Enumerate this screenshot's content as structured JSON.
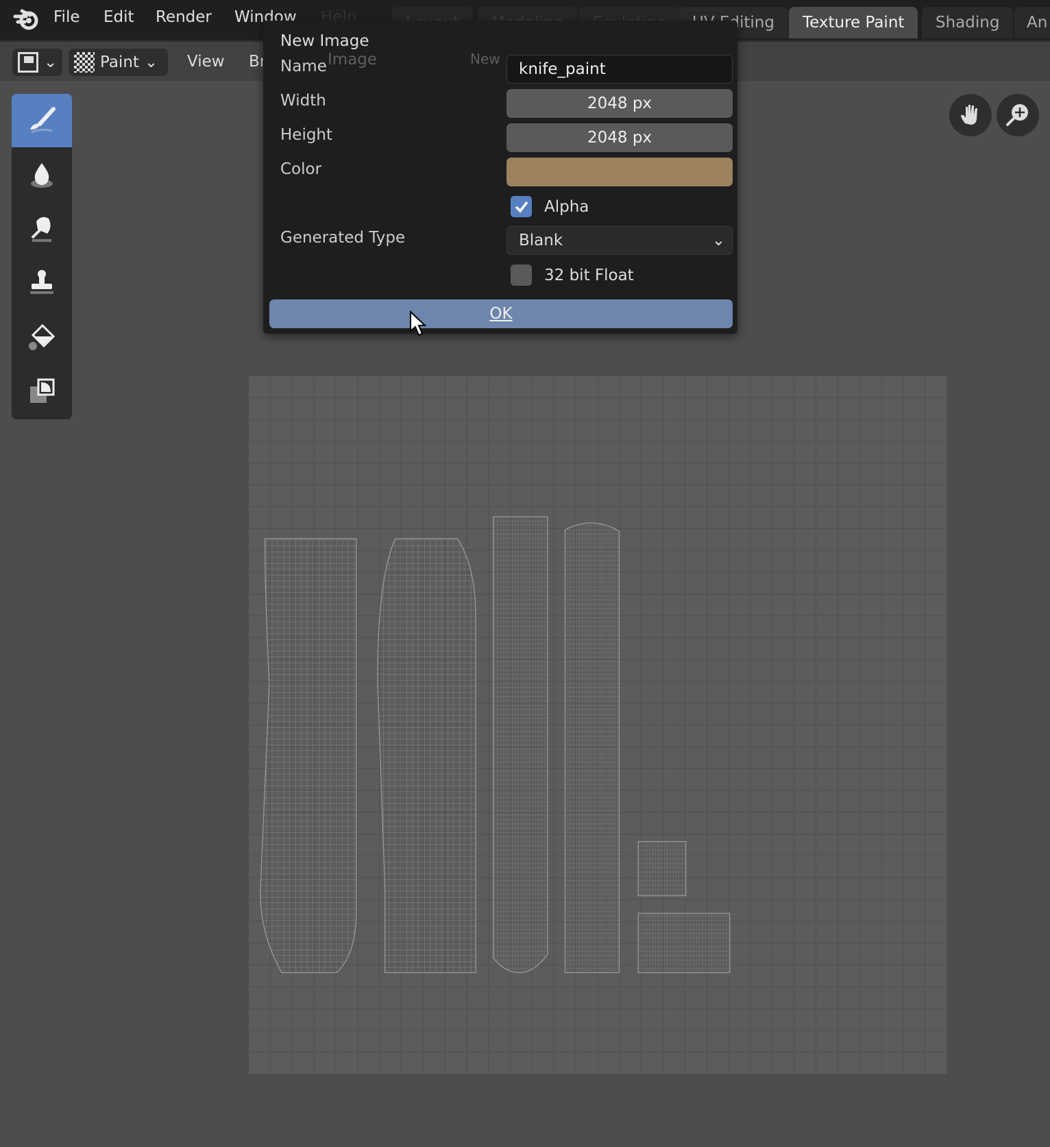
{
  "menu": {
    "logo": "blender-logo",
    "items": [
      "File",
      "Edit",
      "Render",
      "Window",
      "Help"
    ]
  },
  "workspaces": {
    "tabs": [
      "Layout",
      "Modeling",
      "Sculpting",
      "UV Editing",
      "Texture Paint",
      "Shading",
      "An"
    ],
    "active": "Texture Paint"
  },
  "header": {
    "mode": "Paint",
    "items": [
      "View",
      "Brush",
      "Image"
    ],
    "new_label": "New"
  },
  "toolbar": {
    "tools": [
      "draw-brush-icon",
      "soften-icon",
      "smear-icon",
      "clone-stamp-icon",
      "fill-icon",
      "mask-icon"
    ],
    "active": 0
  },
  "dialog": {
    "title": "New Image",
    "name_label": "Name",
    "name_value": "knife_paint",
    "width_label": "Width",
    "width_value": "2048 px",
    "height_label": "Height",
    "height_value": "2048 px",
    "color_label": "Color",
    "color_value": "#9d825e",
    "alpha_label": "Alpha",
    "alpha_checked": true,
    "type_label": "Generated Type",
    "type_value": "Blank",
    "float_label": "32 bit Float",
    "float_checked": false,
    "ok_label": "OK"
  },
  "colors": {
    "accent": "#5680c2",
    "ok_button": "#6e86ad"
  }
}
